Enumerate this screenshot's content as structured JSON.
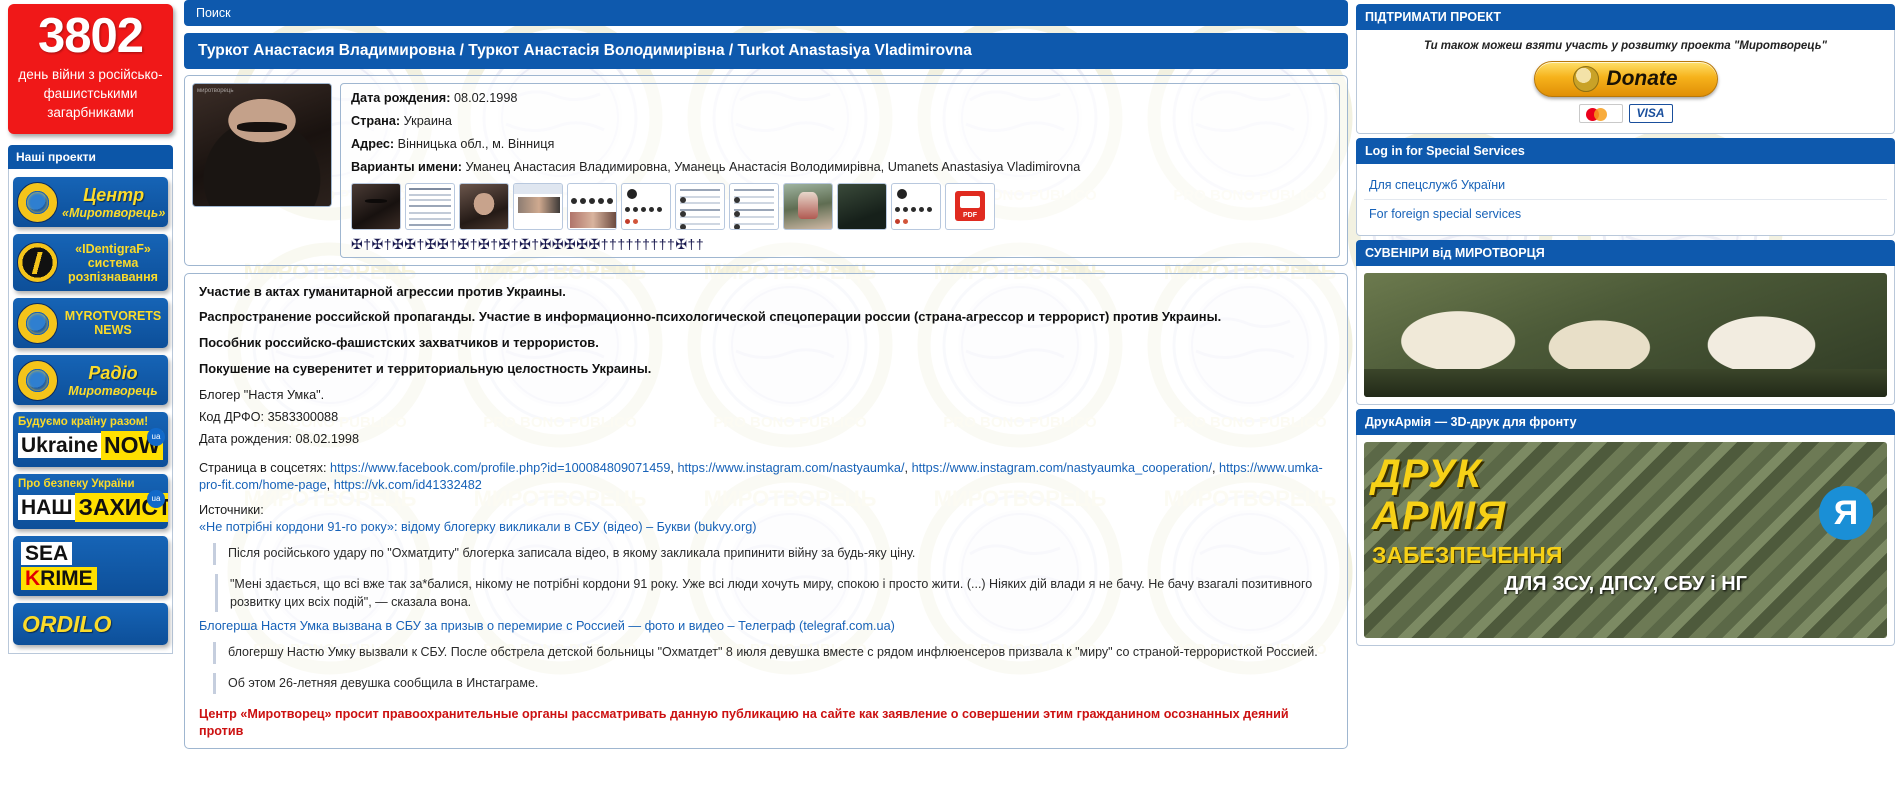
{
  "left": {
    "counter": {
      "days": "3802",
      "caption": "день війни з російсько-фашистськими загарбниками"
    },
    "projects_header": "Наші проекти",
    "projects": [
      {
        "name": "center",
        "line1": "Центр",
        "line2": "«Миротворець»"
      },
      {
        "name": "identigraf",
        "line1": "«IDentigraF»",
        "line2": "система",
        "line3": "розпізнавання"
      },
      {
        "name": "news",
        "line1": "MYROTVORETS",
        "line2": "NEWS"
      },
      {
        "name": "radio",
        "line1": "Радіо",
        "line2": "Миротворець"
      }
    ],
    "banners": [
      {
        "name": "ukraine-now",
        "top": "Будуємо країну разом!",
        "white": "Ukraine",
        "yellow": "NOW",
        "badge": "ua"
      },
      {
        "name": "nash-zahyst",
        "top": "Про безпеку України",
        "white": "НАШ",
        "yellow": "ЗАХИСТ",
        "badge": "ua"
      }
    ],
    "seakrime": {
      "white": "SEA",
      "yellow_k": "K",
      "yellow_rest": "RIME"
    },
    "ordilo": {
      "text": "ORDILO"
    }
  },
  "center": {
    "search_label": "Поиск",
    "page_title": "Туркот Анастасия Владимировна / Туркот Анастасія Володимирівна / Turkot Anastasiya Vladimirovna",
    "photo_watermark": "миротворець",
    "details": [
      {
        "label": "Дата рождения:",
        "value": "08.02.1998"
      },
      {
        "label": "Страна:",
        "value": "Украина"
      },
      {
        "label": "Адрес:",
        "value": "Вінницька обл., м. Вінниця"
      },
      {
        "label": "Варианты имени:",
        "value": "Уманец Анастасия Владимировна, Уманець Анастасія Володимирівна, Umanets Anastasiya Vladimirovna"
      }
    ],
    "thumbnails": [
      "photo-sunglasses",
      "document-screenshot",
      "portrait-photo",
      "facebook-profile",
      "instagram-stories",
      "instagram-profile",
      "social-post",
      "social-feed",
      "photo-outdoor",
      "photo-dark",
      "instagram-grid",
      "pdf-document"
    ],
    "pdf_label": "PDF",
    "crosses": "✠†✠†✠✠†✠✠†✠†✠†✠†✠†✠✠✠✠✠†††††††††✠††",
    "accusations": [
      "Участие в актах гуманитарной агрессии против Украины.",
      "Распространение российской пропаганды. Участие в информационно-психологической спецоперации россии (страна-агрессор и террорист) против Украины.",
      "Пособник российско-фашистских захватчиков и террористов.",
      "Покушение на суверенитет и территориальную целостность Украины."
    ],
    "facts": [
      "Блогер \"Настя Умка\".",
      "Код ДРФО: 3583300088",
      "Дата рождения: 08.02.1998"
    ],
    "social_label": "Страница в соцсетях:",
    "social_links": [
      "https://www.facebook.com/profile.php?id=100084809071459",
      "https://www.instagram.com/nastyaumka/",
      "https://www.instagram.com/nastyaumka_cooperation/",
      "https://www.umka-pro-fit.com/home-page",
      "https://vk.com/id41332482"
    ],
    "sources_label": "Источники:",
    "source_1": "«Не потрібні кордони 91-го року»: відому блогерку викликали в СБУ (відео) – Букви (bukvy.org)",
    "source_1_text": "Після російського удару по \"Охматдиту\" блогерка записала відео, в якому закликала припинити війну за будь-яку ціну.",
    "source_1_quote": "\"Мені здається, що всі вже так зa*балися, нікому не потрібні кордони 91 року. Уже всі люди хочуть миру, спокою і просто жити. (...) Ніяких дій влади я не бачу. Не бачу взагалі позитивного розвитку цих всіх подій\", — сказала вона.",
    "source_2": "Блогерша Настя Умка вызвана в СБУ за призыв о перемирие с Россией — фото и видео – Телеграф (telegraf.com.ua)",
    "source_2_text_a": "блогершу Настю Умку вызвали к СБУ. После обстрела детской больницы \"Охматдет\" 8 июля девушка вместе с рядом инфлюенсеров призвала к \"миру\" со страной-террористкой Россией.",
    "source_2_text_b": "Об этом 26-летняя девушка сообщила в Инстаграме.",
    "source_2_link_b": "Инстаграме",
    "red_note": "Центр «Миротворец» просит правоохранительные органы рассматривать данную публикацию на сайте как заявление о совершении этим гражданином осознанных деяний против"
  },
  "right": {
    "support_header": "ПІДТРИМАТИ ПРОЕКТ",
    "donate_text": "Ти також можеш взяти участь у розвитку проекта \"Миротворець\"",
    "donate_button": "Donate",
    "card_visa": "VISA",
    "login_header": "Log in for Special Services",
    "login_links": [
      "Для спецслужб України",
      "For foreign special services"
    ],
    "souvenirs_header": "СУВЕНІРИ від МИРОТВОРЦЯ",
    "druk_header": "ДрукАрмія — 3D-друк для фронту",
    "druk_line1": "ДРУК",
    "druk_line2": "АРМІЯ",
    "druk_logo": "Я",
    "druk_line3": "ЗАБЕЗПЕЧЕННЯ",
    "druk_line4": "ДЛЯ ЗСУ, ДПСУ, СБУ і НГ"
  },
  "colors": {
    "blue": "#0e59ad",
    "red": "#f01818",
    "yellow": "#fbdb2a",
    "link": "#1762b8"
  }
}
